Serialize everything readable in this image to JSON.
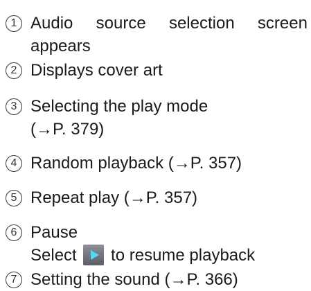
{
  "items": [
    {
      "number": "1",
      "line1_words": [
        "Audio",
        "source",
        "selection",
        "screen"
      ],
      "line2": "appears"
    },
    {
      "number": "2",
      "line1": "Displays cover art"
    },
    {
      "number": "3",
      "line1": "Selecting the play mode",
      "line2": "(→P. 379)"
    },
    {
      "number": "4",
      "line1": "Random playback (→P. 357)"
    },
    {
      "number": "5",
      "line1": "Repeat play (→P. 357)"
    },
    {
      "number": "6",
      "line1": "Pause",
      "line2_pre": "Select",
      "line2_icon": "play-icon",
      "line2_post": "to resume playback"
    },
    {
      "number": "7",
      "line1": "Setting the sound (→P. 366)"
    }
  ]
}
